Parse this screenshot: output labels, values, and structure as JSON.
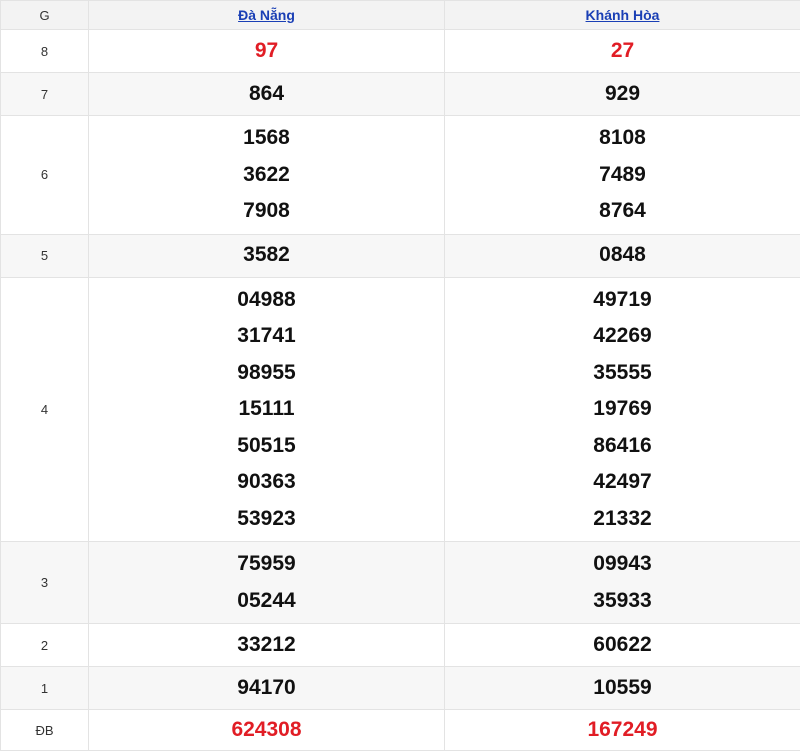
{
  "header": {
    "prize_col": "G",
    "provinces": [
      "Đà Nẵng",
      "Khánh Hòa"
    ]
  },
  "colors": {
    "special_number": "#e11d25",
    "link": "#1a3fb5",
    "row_alt": "#f7f7f7"
  },
  "prizes": [
    {
      "name": "8",
      "red": true,
      "values": [
        [
          "97"
        ],
        [
          "27"
        ]
      ]
    },
    {
      "name": "7",
      "red": false,
      "values": [
        [
          "864"
        ],
        [
          "929"
        ]
      ]
    },
    {
      "name": "6",
      "red": false,
      "values": [
        [
          "1568",
          "3622",
          "7908"
        ],
        [
          "8108",
          "7489",
          "8764"
        ]
      ]
    },
    {
      "name": "5",
      "red": false,
      "values": [
        [
          "3582"
        ],
        [
          "0848"
        ]
      ]
    },
    {
      "name": "4",
      "red": false,
      "values": [
        [
          "04988",
          "31741",
          "98955",
          "15111",
          "50515",
          "90363",
          "53923"
        ],
        [
          "49719",
          "42269",
          "35555",
          "19769",
          "86416",
          "42497",
          "21332"
        ]
      ]
    },
    {
      "name": "3",
      "red": false,
      "values": [
        [
          "75959",
          "05244"
        ],
        [
          "09943",
          "35933"
        ]
      ]
    },
    {
      "name": "2",
      "red": false,
      "values": [
        [
          "33212"
        ],
        [
          "60622"
        ]
      ]
    },
    {
      "name": "1",
      "red": false,
      "values": [
        [
          "94170"
        ],
        [
          "10559"
        ]
      ]
    },
    {
      "name": "ĐB",
      "red": true,
      "values": [
        [
          "624308"
        ],
        [
          "167249"
        ]
      ]
    }
  ]
}
